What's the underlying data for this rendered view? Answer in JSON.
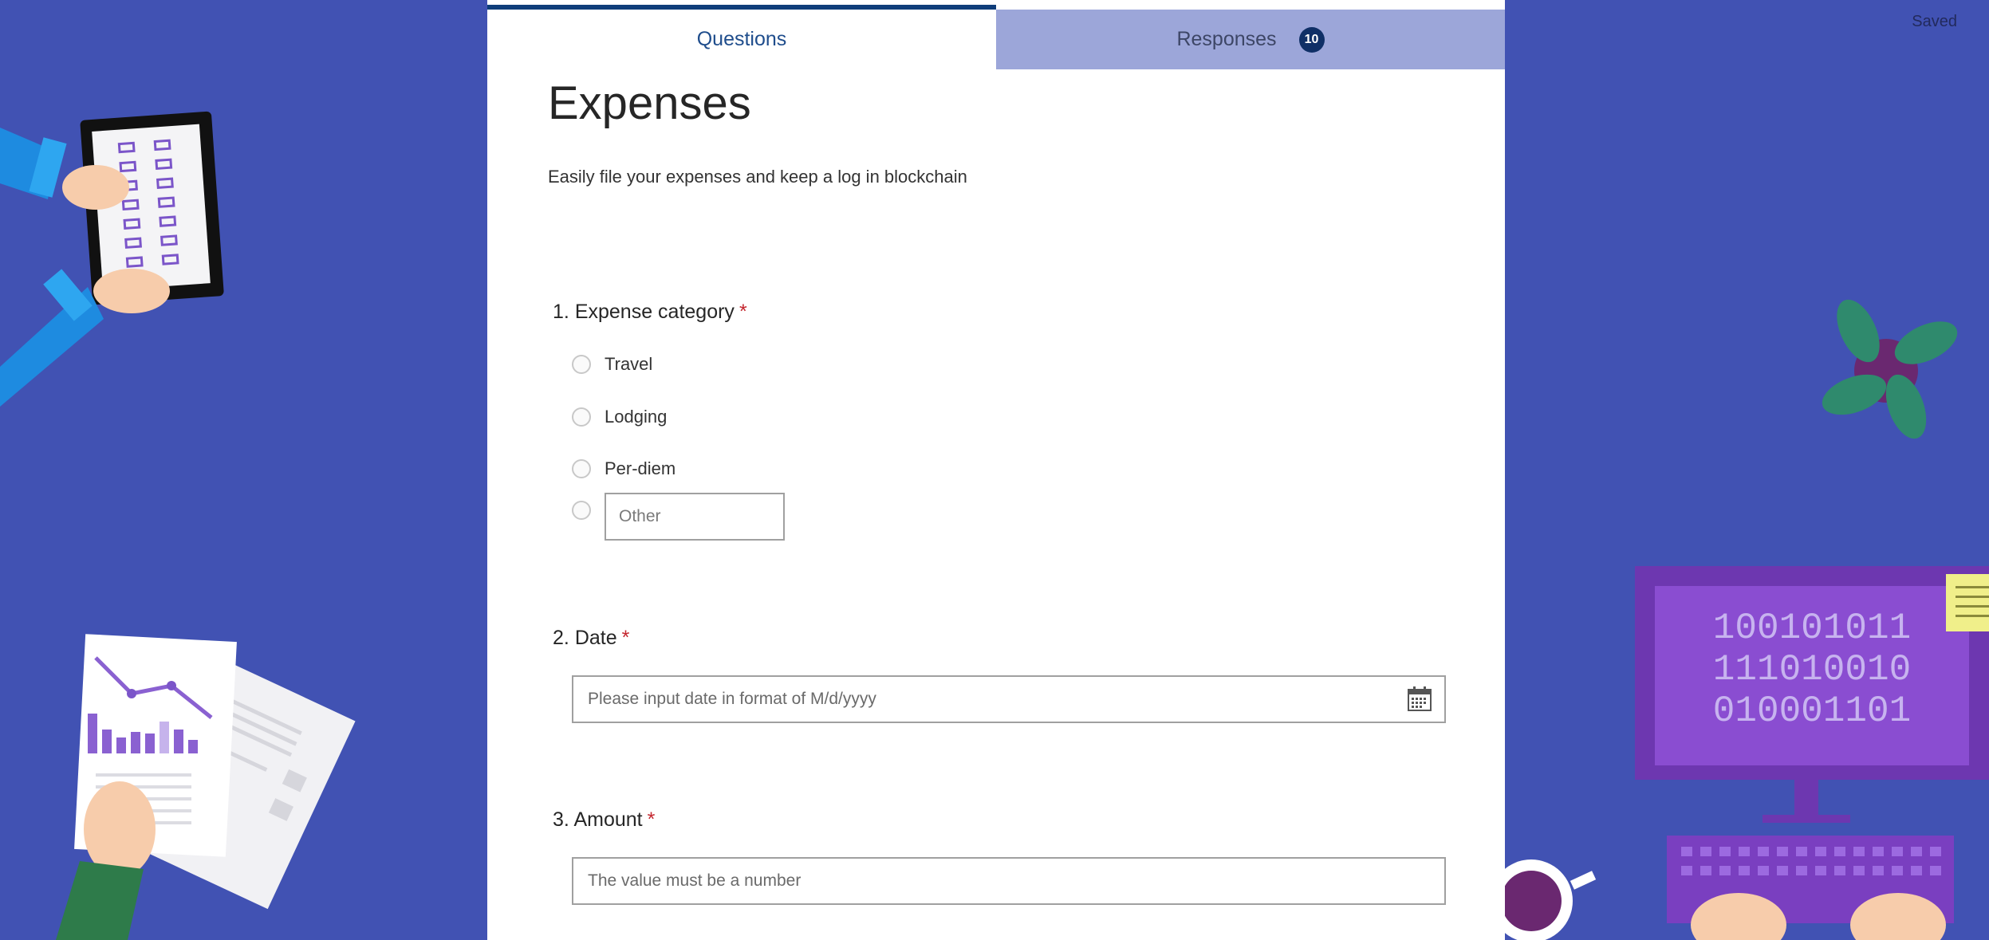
{
  "status": {
    "saved": "Saved"
  },
  "tabs": {
    "questions": "Questions",
    "responses": "Responses",
    "responses_count": "10"
  },
  "form": {
    "title": "Expenses",
    "description": "Easily file your expenses and keep a log in blockchain",
    "questions": [
      {
        "number": "1.",
        "label": "Expense category",
        "required": "*",
        "options": [
          "Travel",
          "Lodging",
          "Per-diem"
        ],
        "other_placeholder": "Other"
      },
      {
        "number": "2.",
        "label": "Date",
        "required": "*",
        "placeholder": "Please input date in format of M/d/yyyy",
        "icon": "calendar-icon"
      },
      {
        "number": "3.",
        "label": "Amount",
        "required": "*",
        "placeholder": "The value must be a number"
      }
    ]
  },
  "decorations": {
    "monitor_text": [
      "100101011",
      "111010010",
      "010001101"
    ]
  },
  "colors": {
    "background": "#4152b3",
    "accent": "#0f3d7a",
    "required": "#c4262e",
    "responses_tab": "#9ca6d9"
  }
}
